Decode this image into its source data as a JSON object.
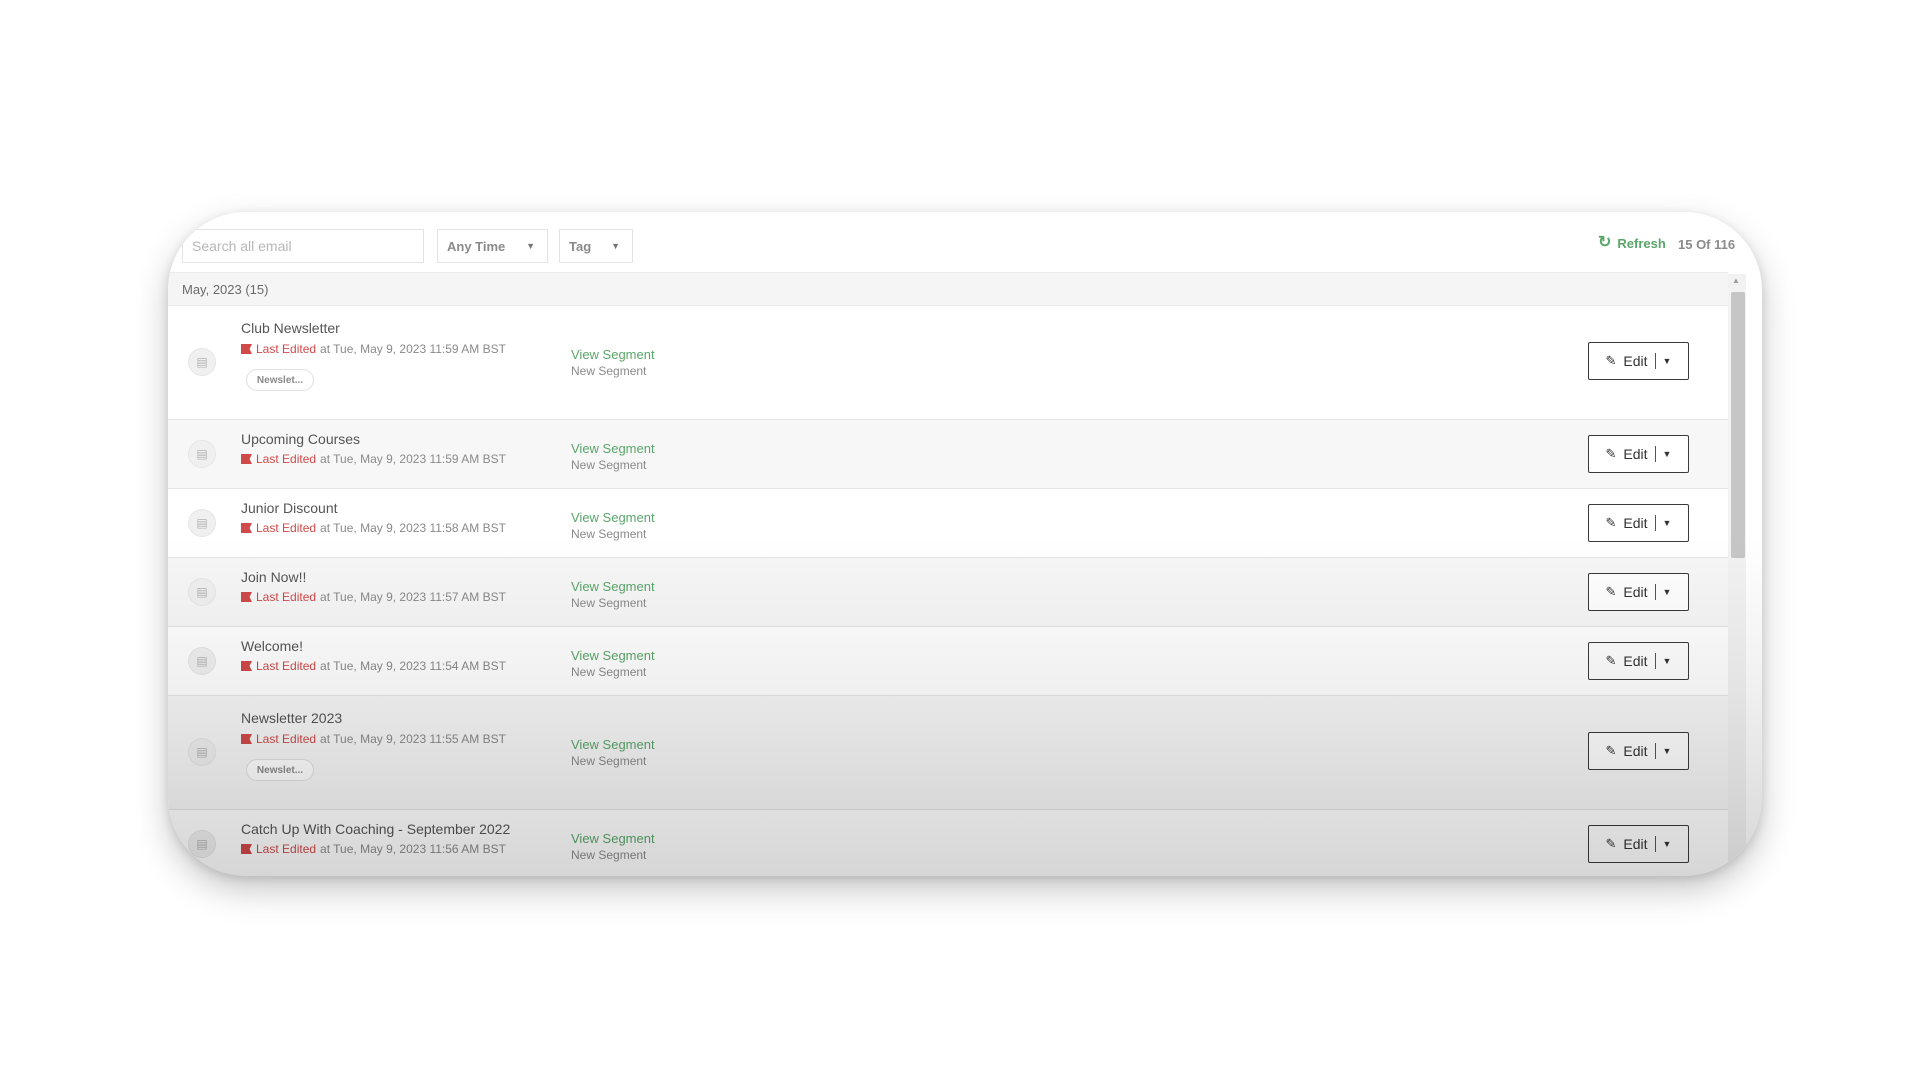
{
  "toolbar": {
    "search_placeholder": "Search all email",
    "time_filter": "Any Time",
    "tag_filter": "Tag",
    "refresh_label": "Refresh",
    "count_text": "15 Of 116"
  },
  "group": {
    "label": "May, 2023 (15)"
  },
  "emails": [
    {
      "title": "Club Newsletter",
      "last_edited_label": "Last Edited",
      "edited_at": "at Tue, May 9, 2023 11:59 AM BST",
      "tag": "Newslet...",
      "view_segment": "View Segment",
      "segment": "New Segment",
      "edit_label": "Edit"
    },
    {
      "title": "Upcoming Courses",
      "last_edited_label": "Last Edited",
      "edited_at": "at Tue, May 9, 2023 11:59 AM BST",
      "tag": null,
      "view_segment": "View Segment",
      "segment": "New Segment",
      "edit_label": "Edit"
    },
    {
      "title": "Junior Discount",
      "last_edited_label": "Last Edited",
      "edited_at": "at Tue, May 9, 2023 11:58 AM BST",
      "tag": null,
      "view_segment": "View Segment",
      "segment": "New Segment",
      "edit_label": "Edit"
    },
    {
      "title": "Join Now!!",
      "last_edited_label": "Last Edited",
      "edited_at": "at Tue, May 9, 2023 11:57 AM BST",
      "tag": null,
      "view_segment": "View Segment",
      "segment": "New Segment",
      "edit_label": "Edit"
    },
    {
      "title": "Welcome!",
      "last_edited_label": "Last Edited",
      "edited_at": "at Tue, May 9, 2023 11:54 AM BST",
      "tag": null,
      "view_segment": "View Segment",
      "segment": "New Segment",
      "edit_label": "Edit"
    },
    {
      "title": "Newsletter 2023",
      "last_edited_label": "Last Edited",
      "edited_at": "at Tue, May 9, 2023 11:55 AM BST",
      "tag": "Newslet...",
      "view_segment": "View Segment",
      "segment": "New Segment",
      "edit_label": "Edit"
    },
    {
      "title": "Catch Up With Coaching - September 2022",
      "last_edited_label": "Last Edited",
      "edited_at": "at Tue, May 9, 2023 11:56 AM BST",
      "tag": null,
      "view_segment": "View Segment",
      "segment": "New Segment",
      "edit_label": "Edit"
    }
  ],
  "colors": {
    "accent_green": "#5aa66a",
    "last_edited_red": "#d04a4a",
    "muted_text": "#8a8a8a"
  },
  "icons": {
    "refresh": "refresh-icon",
    "email": "email-doc-icon",
    "last_edited": "flag-icon",
    "edit": "edit-icon",
    "caret": "chevron-down-icon"
  }
}
